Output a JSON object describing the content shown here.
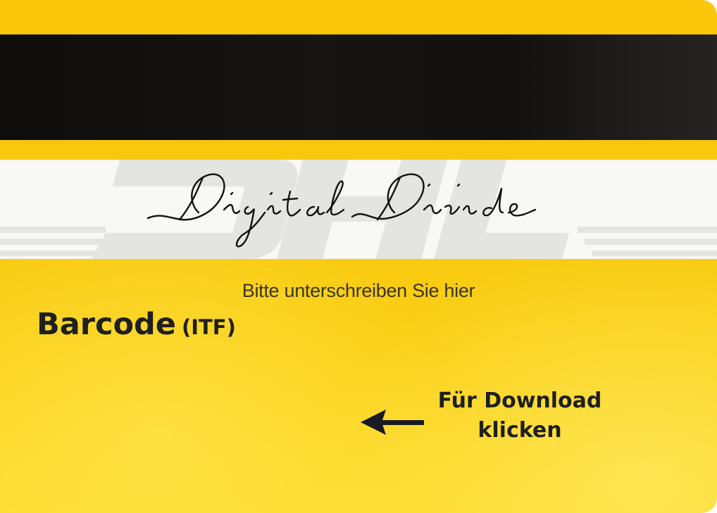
{
  "card": {
    "sign_here_text": "Bitte unterschreiben Sie hier",
    "signature_text": "Digital Divide",
    "watermark_logo": "DHL",
    "barcode_title": "Barcode",
    "barcode_type": "(ITF)",
    "download_line1": "Für Download",
    "download_line2": "klicken"
  },
  "colors": {
    "card_yellow": "#f9c60a",
    "magnetic_stripe": "#121110",
    "signature_strip": "#f8f8f4",
    "text_dark": "#1f1f1f"
  },
  "icons": {
    "arrow": "arrow-left-icon"
  }
}
